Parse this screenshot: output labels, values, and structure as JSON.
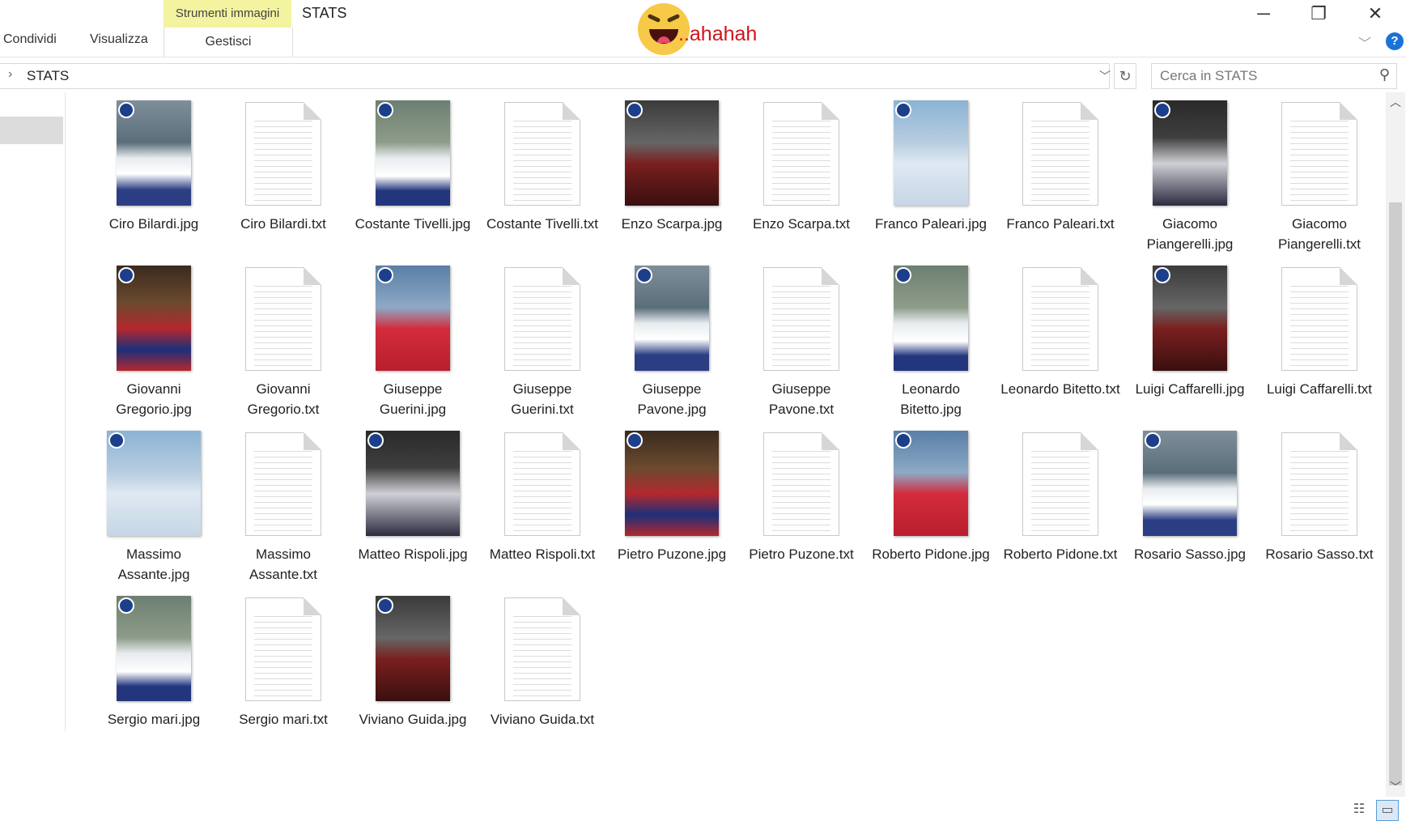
{
  "ribbon": {
    "tabs": [
      "Condividi",
      "Visualizza"
    ],
    "contextual_header": "Strumenti immagini",
    "contextual_tab": "Gestisci",
    "window_title": "STATS",
    "overlay_text": "..ahahah",
    "overlay_icon": "laughing-emoji-icon",
    "window_controls": {
      "minimize": "─",
      "restore": "❐",
      "close": "✕"
    },
    "expand_icon": "﹀",
    "help_icon": "?"
  },
  "address_bar": {
    "path": "STATS",
    "arrow": "›",
    "dropdown": "﹀",
    "refresh": "↻"
  },
  "search": {
    "placeholder": "Cerca in STATS",
    "icon": "⚲"
  },
  "files": [
    {
      "name": "Ciro Bilardi.jpg",
      "type": "image"
    },
    {
      "name": "Ciro Bilardi.txt",
      "type": "text"
    },
    {
      "name": "Costante Tivelli.jpg",
      "type": "image"
    },
    {
      "name": "Costante Tivelli.txt",
      "type": "text"
    },
    {
      "name": "Enzo Scarpa.jpg",
      "type": "image"
    },
    {
      "name": "Enzo Scarpa.txt",
      "type": "text"
    },
    {
      "name": "Franco Paleari.jpg",
      "type": "image"
    },
    {
      "name": "Franco Paleari.txt",
      "type": "text"
    },
    {
      "name": "Giacomo Piangerelli.jpg",
      "type": "image"
    },
    {
      "name": "Giacomo Piangerelli.txt",
      "type": "text"
    },
    {
      "name": "Giovanni Gregorio.jpg",
      "type": "image"
    },
    {
      "name": "Giovanni Gregorio.txt",
      "type": "text"
    },
    {
      "name": "Giuseppe Guerini.jpg",
      "type": "image"
    },
    {
      "name": "Giuseppe Guerini.txt",
      "type": "text"
    },
    {
      "name": "Giuseppe Pavone.jpg",
      "type": "image"
    },
    {
      "name": "Giuseppe Pavone.txt",
      "type": "text"
    },
    {
      "name": "Leonardo Bitetto.jpg",
      "type": "image"
    },
    {
      "name": "Leonardo Bitetto.txt",
      "type": "text"
    },
    {
      "name": "Luigi Caffarelli.jpg",
      "type": "image"
    },
    {
      "name": "Luigi Caffarelli.txt",
      "type": "text"
    },
    {
      "name": "Massimo Assante.jpg",
      "type": "image"
    },
    {
      "name": "Massimo Assante.txt",
      "type": "text"
    },
    {
      "name": "Matteo Rispoli.jpg",
      "type": "image"
    },
    {
      "name": "Matteo Rispoli.txt",
      "type": "text"
    },
    {
      "name": "Pietro Puzone.jpg",
      "type": "image"
    },
    {
      "name": "Pietro Puzone.txt",
      "type": "text"
    },
    {
      "name": "Roberto Pidone.jpg",
      "type": "image"
    },
    {
      "name": "Roberto Pidone.txt",
      "type": "text"
    },
    {
      "name": "Rosario Sasso.jpg",
      "type": "image"
    },
    {
      "name": "Rosario Sasso.txt",
      "type": "text"
    },
    {
      "name": "Sergio mari.jpg",
      "type": "image"
    },
    {
      "name": "Sergio mari.txt",
      "type": "text"
    },
    {
      "name": "Viviano Guida.jpg",
      "type": "image"
    },
    {
      "name": "Viviano Guida.txt",
      "type": "text"
    }
  ],
  "scrollbar": {
    "up": "︿",
    "down": "﹀"
  },
  "view_buttons": {
    "details": "☷",
    "large_icons": "▭"
  },
  "colors": {
    "contextual_tab_bg": "#f3f3a0",
    "overlay_text": "#d0131c",
    "help_blue": "#1a73d9",
    "selection_gray": "#dcdcdc"
  }
}
